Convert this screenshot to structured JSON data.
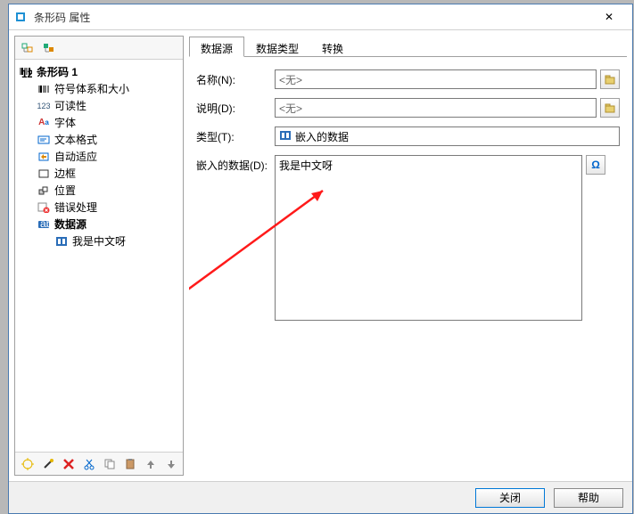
{
  "window": {
    "title": "条形码 属性",
    "close": "✕"
  },
  "leftToolbar": {
    "btn1": "⊞",
    "btn2": "⊡"
  },
  "tree": {
    "root": "条形码 1",
    "items": [
      {
        "label": "符号体系和大小"
      },
      {
        "label": "可读性"
      },
      {
        "label": "字体"
      },
      {
        "label": "文本格式"
      },
      {
        "label": "自动适应"
      },
      {
        "label": "边框"
      },
      {
        "label": "位置"
      },
      {
        "label": "错误处理"
      },
      {
        "label": "数据源",
        "bold": true
      }
    ],
    "datasourceChild": "我是中文呀"
  },
  "bottomToolbar": {
    "new": "✳",
    "wizard": "✎",
    "delete": "✖",
    "cut": "✂",
    "copy": "⎘",
    "paste": "📋",
    "up": "⬆",
    "down": "⬇"
  },
  "tabs": {
    "t1": "数据源",
    "t2": "数据类型",
    "t3": "转换"
  },
  "form": {
    "nameLabel": "名称(N):",
    "nameValue": "<无>",
    "descLabel": "说明(D):",
    "descValue": "<无>",
    "typeLabel": "类型(T):",
    "typeValue": "嵌入的数据",
    "dataLabel": "嵌入的数据(D):",
    "dataValue": "我是中文呀",
    "omega": "Ω"
  },
  "footer": {
    "close": "关闭",
    "help": "帮助"
  }
}
